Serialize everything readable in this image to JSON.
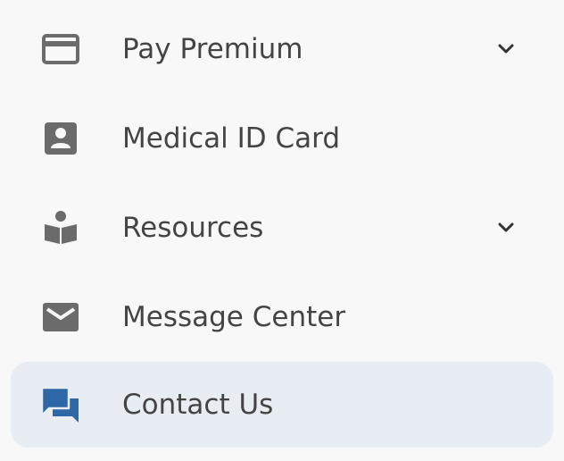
{
  "menu": {
    "items": [
      {
        "label": "Pay Premium",
        "icon": "credit-card-icon",
        "has_chevron": true,
        "active": false
      },
      {
        "label": "Medical ID Card",
        "icon": "id-card-icon",
        "has_chevron": false,
        "active": false
      },
      {
        "label": "Resources",
        "icon": "book-reader-icon",
        "has_chevron": true,
        "active": false
      },
      {
        "label": "Message Center",
        "icon": "envelope-icon",
        "has_chevron": false,
        "active": false
      },
      {
        "label": "Contact Us",
        "icon": "chat-bubbles-icon",
        "has_chevron": false,
        "active": true
      }
    ]
  },
  "colors": {
    "icon_default": "#6b6b6b",
    "icon_active": "#2e67a5",
    "text": "#444444",
    "active_background": "#e7edf3",
    "background": "#f8f8f8"
  }
}
